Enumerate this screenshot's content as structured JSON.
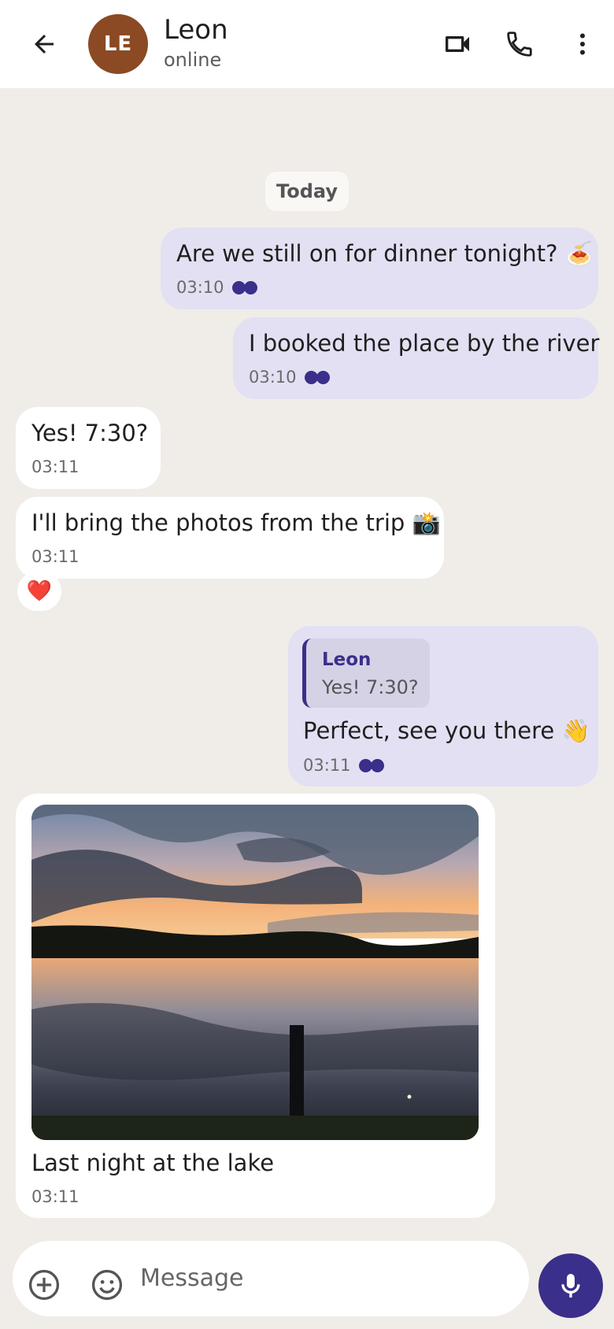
{
  "header": {
    "avatar_initials": "LE",
    "avatar_color": "#8b4a23",
    "contact_name": "Leon",
    "status": "online",
    "icons": [
      "arrow-left-icon",
      "video-camera-icon",
      "phone-icon",
      "more-vertical-icon"
    ]
  },
  "date_separator": "Today",
  "messages": [
    {
      "direction": "outgoing",
      "text": "Are we still on for dinner tonight? 🍝",
      "time": "03:10",
      "status": "read"
    },
    {
      "direction": "outgoing",
      "text": "I booked the place by the river",
      "time": "03:10",
      "status": "read"
    },
    {
      "direction": "incoming",
      "text": "Yes! 7:30?",
      "time": "03:11"
    },
    {
      "direction": "incoming",
      "text": "I'll bring the photos from the trip 📸",
      "time": "03:11",
      "reaction": "❤️"
    },
    {
      "direction": "outgoing",
      "reply_to": {
        "author": "Leon",
        "text": "Yes! 7:30?"
      },
      "text": "Perfect, see you there 👋",
      "time": "03:11",
      "status": "read"
    },
    {
      "direction": "incoming",
      "type": "photo",
      "caption": "Last night at the lake",
      "time": "03:11"
    }
  ],
  "composer": {
    "placeholder": "Message",
    "icons": [
      "add-circle-icon",
      "emoji-icon",
      "microphone-icon"
    ]
  },
  "colors": {
    "chat_background": "#f0ede8",
    "outgoing_bubble": "#e3e0f3",
    "incoming_bubble": "#ffffff",
    "accent": "#3a2f8a"
  }
}
